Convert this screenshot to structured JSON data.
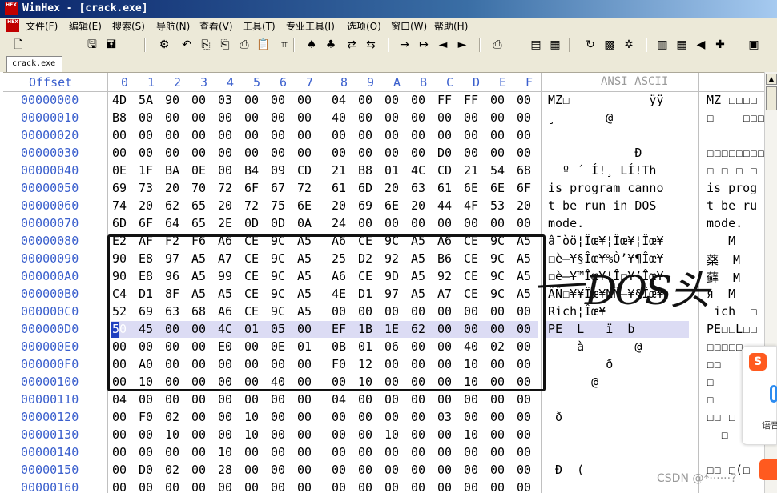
{
  "window": {
    "title": "WinHex - [crack.exe]",
    "logo_text": "HEX"
  },
  "menu": {
    "items": [
      "文件(F)",
      "编辑(E)",
      "搜索(S)",
      "导航(N)",
      "查看(V)",
      "工具(T)",
      "专业工具(I)",
      "选项(O)",
      "窗口(W)",
      "帮助(H)"
    ]
  },
  "toolbar": {
    "icons": [
      "new-file-icon",
      "open-icon",
      "save-icon",
      "properties-icon",
      "undo-icon",
      "copy-icon",
      "paste-icon",
      "paste-block-icon",
      "clipboard-icon",
      "binary-icon",
      "find-text-icon",
      "find-hex-icon",
      "replace-text-icon",
      "replace-hex-icon",
      "goto-offset-icon",
      "goto-arrow-icon",
      "back-icon",
      "forward-icon",
      "print-icon",
      "disk-icon",
      "ram-icon",
      "refresh-icon",
      "image-icon",
      "settings-icon",
      "calc-icon",
      "table-icon",
      "prev-icon",
      "next-plus-icon",
      "help-book-icon"
    ]
  },
  "tab": {
    "label": "crack.exe"
  },
  "header": {
    "offset": "Offset",
    "columns": [
      "0",
      "1",
      "2",
      "3",
      "4",
      "5",
      "6",
      "7",
      "8",
      "9",
      "A",
      "B",
      "C",
      "D",
      "E",
      "F"
    ],
    "ansi_ascii": "ANSI ASCII"
  },
  "rows": [
    {
      "offset": "00000000",
      "hex": [
        "4D",
        "5A",
        "90",
        "00",
        "03",
        "00",
        "00",
        "00",
        "04",
        "00",
        "00",
        "00",
        "FF",
        "FF",
        "00",
        "00"
      ],
      "ansi": "MZ☐           ÿÿ",
      "ascii": "MZ ☐☐☐☐"
    },
    {
      "offset": "00000010",
      "hex": [
        "B8",
        "00",
        "00",
        "00",
        "00",
        "00",
        "00",
        "00",
        "40",
        "00",
        "00",
        "00",
        "00",
        "00",
        "00",
        "00"
      ],
      "ansi": "¸       @",
      "ascii": "☐    ☐☐☐"
    },
    {
      "offset": "00000020",
      "hex": [
        "00",
        "00",
        "00",
        "00",
        "00",
        "00",
        "00",
        "00",
        "00",
        "00",
        "00",
        "00",
        "00",
        "00",
        "00",
        "00"
      ],
      "ansi": "",
      "ascii": ""
    },
    {
      "offset": "00000030",
      "hex": [
        "00",
        "00",
        "00",
        "00",
        "00",
        "00",
        "00",
        "00",
        "00",
        "00",
        "00",
        "00",
        "D0",
        "00",
        "00",
        "00"
      ],
      "ansi": "            Ð",
      "ascii": "☐☐☐☐☐☐☐☐"
    },
    {
      "offset": "00000040",
      "hex": [
        "0E",
        "1F",
        "BA",
        "0E",
        "00",
        "B4",
        "09",
        "CD",
        "21",
        "B8",
        "01",
        "4C",
        "CD",
        "21",
        "54",
        "68"
      ],
      "ansi": "  º ´ Í!¸ LÍ!Th",
      "ascii": "☐ ☐ ☐ ☐"
    },
    {
      "offset": "00000050",
      "hex": [
        "69",
        "73",
        "20",
        "70",
        "72",
        "6F",
        "67",
        "72",
        "61",
        "6D",
        "20",
        "63",
        "61",
        "6E",
        "6E",
        "6F"
      ],
      "ansi": "is program canno",
      "ascii": "is prog"
    },
    {
      "offset": "00000060",
      "hex": [
        "74",
        "20",
        "62",
        "65",
        "20",
        "72",
        "75",
        "6E",
        "20",
        "69",
        "6E",
        "20",
        "44",
        "4F",
        "53",
        "20"
      ],
      "ansi": "t be run in DOS ",
      "ascii": "t be ru"
    },
    {
      "offset": "00000070",
      "hex": [
        "6D",
        "6F",
        "64",
        "65",
        "2E",
        "0D",
        "0D",
        "0A",
        "24",
        "00",
        "00",
        "00",
        "00",
        "00",
        "00",
        "00"
      ],
      "ansi": "mode.",
      "ascii": "mode."
    },
    {
      "offset": "00000080",
      "hex": [
        "E2",
        "AF",
        "F2",
        "F6",
        "A6",
        "CE",
        "9C",
        "A5",
        "A6",
        "CE",
        "9C",
        "A5",
        "A6",
        "CE",
        "9C",
        "A5"
      ],
      "ansi": "â¯òö¦Îœ¥¦Îœ¥¦Îœ¥",
      "ascii": "   M"
    },
    {
      "offset": "00000090",
      "hex": [
        "90",
        "E8",
        "97",
        "A5",
        "A7",
        "CE",
        "9C",
        "A5",
        "25",
        "D2",
        "92",
        "A5",
        "B6",
        "CE",
        "9C",
        "A5"
      ],
      "ansi": "☐è—¥§Îœ¥%Ò’¥¶Îœ¥",
      "ascii": "薬  M"
    },
    {
      "offset": "000000A0",
      "hex": [
        "90",
        "E8",
        "96",
        "A5",
        "99",
        "CE",
        "9C",
        "A5",
        "A6",
        "CE",
        "9D",
        "A5",
        "92",
        "CE",
        "9C",
        "A5"
      ],
      "ansi": "☐è–¥™Îœ¥¦Î☐¥’Îœ¥",
      "ascii": "藓  M"
    },
    {
      "offset": "000000B0",
      "hex": [
        "C4",
        "D1",
        "8F",
        "A5",
        "A5",
        "CE",
        "9C",
        "A5",
        "4E",
        "D1",
        "97",
        "A5",
        "A7",
        "CE",
        "9C",
        "A5"
      ],
      "ansi": "ÄÑ☐¥¥Îœ¥NÑ—¥§Îœ¥",
      "ascii": "я  M"
    },
    {
      "offset": "000000C0",
      "hex": [
        "52",
        "69",
        "63",
        "68",
        "A6",
        "CE",
        "9C",
        "A5",
        "00",
        "00",
        "00",
        "00",
        "00",
        "00",
        "00",
        "00"
      ],
      "ansi": "Rich¦Îœ¥",
      "ascii": " ich  ☐"
    },
    {
      "offset": "000000D0",
      "hex": [
        "50",
        "45",
        "00",
        "00",
        "4C",
        "01",
        "05",
        "00",
        "EF",
        "1B",
        "1E",
        "62",
        "00",
        "00",
        "00",
        "00"
      ],
      "ansi": "PE  L   ï  b",
      "ascii": "PE☐☐L☐☐"
    },
    {
      "offset": "000000E0",
      "hex": [
        "00",
        "00",
        "00",
        "00",
        "E0",
        "00",
        "0E",
        "01",
        "0B",
        "01",
        "06",
        "00",
        "00",
        "40",
        "02",
        "00"
      ],
      "ansi": "    à       @",
      "ascii": "☐☐☐☐☐"
    },
    {
      "offset": "000000F0",
      "hex": [
        "00",
        "A0",
        "00",
        "00",
        "00",
        "00",
        "00",
        "00",
        "F0",
        "12",
        "00",
        "00",
        "00",
        "10",
        "00",
        "00"
      ],
      "ansi": "        ð",
      "ascii": "☐☐"
    },
    {
      "offset": "00000100",
      "hex": [
        "00",
        "10",
        "00",
        "00",
        "00",
        "00",
        "40",
        "00",
        "00",
        "10",
        "00",
        "00",
        "00",
        "10",
        "00",
        "00"
      ],
      "ansi": "      @",
      "ascii": "☐"
    },
    {
      "offset": "00000110",
      "hex": [
        "04",
        "00",
        "00",
        "00",
        "00",
        "00",
        "00",
        "00",
        "04",
        "00",
        "00",
        "00",
        "00",
        "00",
        "00",
        "00"
      ],
      "ansi": "",
      "ascii": "☐"
    },
    {
      "offset": "00000120",
      "hex": [
        "00",
        "F0",
        "02",
        "00",
        "00",
        "10",
        "00",
        "00",
        "00",
        "00",
        "00",
        "00",
        "03",
        "00",
        "00",
        "00"
      ],
      "ansi": " ð",
      "ascii": "☐☐ ☐"
    },
    {
      "offset": "00000130",
      "hex": [
        "00",
        "00",
        "10",
        "00",
        "00",
        "10",
        "00",
        "00",
        "00",
        "00",
        "10",
        "00",
        "00",
        "10",
        "00",
        "00"
      ],
      "ansi": "",
      "ascii": "  ☐"
    },
    {
      "offset": "00000140",
      "hex": [
        "00",
        "00",
        "00",
        "00",
        "10",
        "00",
        "00",
        "00",
        "00",
        "00",
        "00",
        "00",
        "00",
        "00",
        "00",
        "00"
      ],
      "ansi": "",
      "ascii": ""
    },
    {
      "offset": "00000150",
      "hex": [
        "00",
        "D0",
        "02",
        "00",
        "28",
        "00",
        "00",
        "00",
        "00",
        "00",
        "00",
        "00",
        "00",
        "00",
        "00",
        "00"
      ],
      "ansi": " Ð  (",
      "ascii": "☐☐ ☐(☐"
    },
    {
      "offset": "00000160",
      "hex": [
        "00",
        "00",
        "00",
        "00",
        "00",
        "00",
        "00",
        "00",
        "00",
        "00",
        "00",
        "00",
        "00",
        "00",
        "00",
        "00"
      ],
      "ansi": "",
      "ascii": ""
    }
  ],
  "selection": {
    "row_index": 13,
    "cursor_byte": 0
  },
  "annotation": {
    "text": "DOS头"
  },
  "ime": {
    "label": "语音",
    "logo_text": "S"
  },
  "watermark": "CSDN @*······?",
  "colors": {
    "offset_blue": "#3a5fcd",
    "selection": "#dcdcf4",
    "cursor": "#2040c0",
    "title_bar": "#0a246a"
  }
}
